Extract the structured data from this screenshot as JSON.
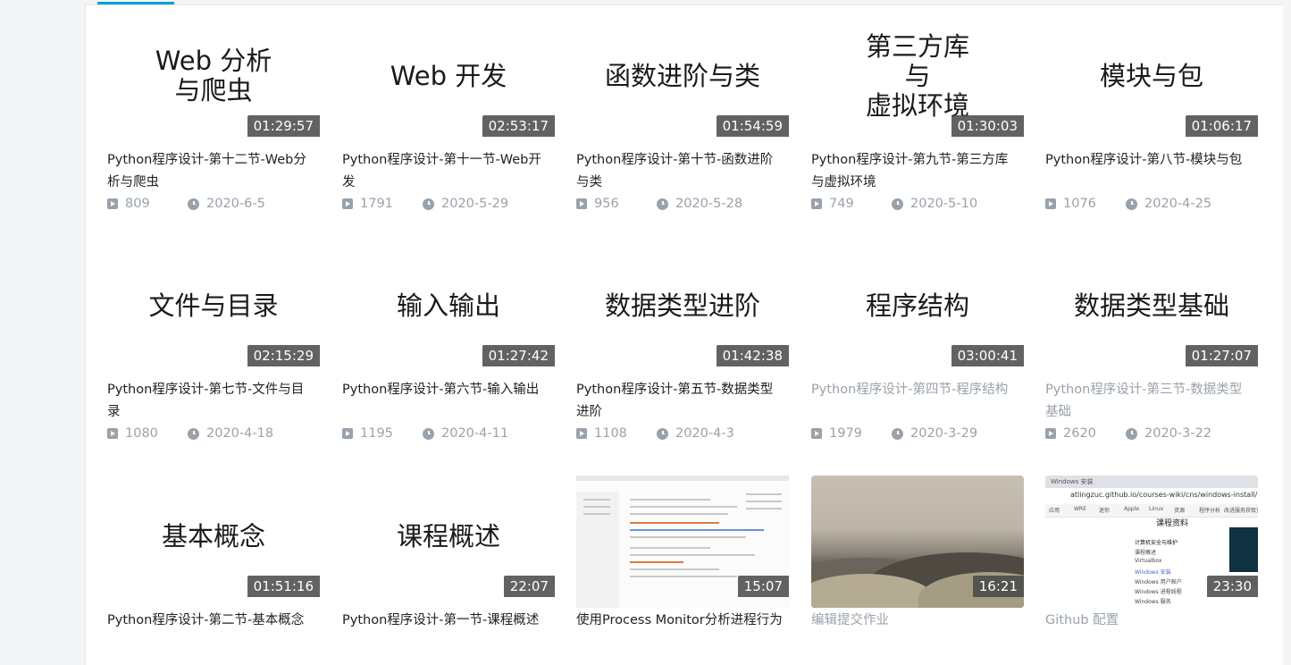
{
  "videos": [
    {
      "thumb_text": "Web 分析\n与爬虫",
      "duration": "01:29:57",
      "title": "Python程序设计-第十二节-Web分析与爬虫",
      "plays": "809",
      "date": "2020-6-5",
      "visited": false
    },
    {
      "thumb_text": "Web 开发",
      "duration": "02:53:17",
      "title": "Python程序设计-第十一节-Web开发",
      "plays": "1791",
      "date": "2020-5-29",
      "visited": false
    },
    {
      "thumb_text": "函数进阶与类",
      "duration": "01:54:59",
      "title": "Python程序设计-第十节-函数进阶与类",
      "plays": "956",
      "date": "2020-5-28",
      "visited": false
    },
    {
      "thumb_text": "第三方库\n与\n虚拟环境",
      "duration": "01:30:03",
      "title": "Python程序设计-第九节-第三方库与虚拟环境",
      "plays": "749",
      "date": "2020-5-10",
      "visited": false
    },
    {
      "thumb_text": "模块与包",
      "duration": "01:06:17",
      "title": "Python程序设计-第八节-模块与包",
      "plays": "1076",
      "date": "2020-4-25",
      "visited": false
    },
    {
      "thumb_text": "文件与目录",
      "duration": "02:15:29",
      "title": "Python程序设计-第七节-文件与目录",
      "plays": "1080",
      "date": "2020-4-18",
      "visited": false
    },
    {
      "thumb_text": "输入输出",
      "duration": "01:27:42",
      "title": "Python程序设计-第六节-输入输出",
      "plays": "1195",
      "date": "2020-4-11",
      "visited": false
    },
    {
      "thumb_text": "数据类型进阶",
      "duration": "01:42:38",
      "title": "Python程序设计-第五节-数据类型进阶",
      "plays": "1108",
      "date": "2020-4-3",
      "visited": false
    },
    {
      "thumb_text": "程序结构",
      "duration": "03:00:41",
      "title": "Python程序设计-第四节-程序结构",
      "plays": "1979",
      "date": "2020-3-29",
      "visited": true
    },
    {
      "thumb_text": "数据类型基础",
      "duration": "01:27:07",
      "title": "Python程序设计-第三节-数据类型基础",
      "plays": "2620",
      "date": "2020-3-22",
      "visited": true
    },
    {
      "thumb_text": "基本概念",
      "duration": "01:51:16",
      "title": "Python程序设计-第二节-基本概念",
      "plays": null,
      "date": null,
      "visited": false
    },
    {
      "thumb_text": "课程概述",
      "duration": "22:07",
      "title": "Python程序设计-第一节-课程概述",
      "plays": null,
      "date": null,
      "visited": false
    },
    {
      "thumb_text": "",
      "duration": "15:07",
      "title": "使用Process Monitor分析进程行为",
      "plays": null,
      "date": null,
      "visited": false
    },
    {
      "thumb_text": "",
      "duration": "16:21",
      "title": "编辑提交作业",
      "plays": null,
      "date": null,
      "visited": true
    },
    {
      "thumb_text": "",
      "duration": "23:30",
      "title": "Github 配置",
      "plays": null,
      "date": null,
      "visited": true
    }
  ],
  "shot_c_text": {
    "tab": "Windows 安装",
    "url": "atlingzuc.github.io/courses-wiki/cns/windows-install/",
    "bookmarks": [
      "应用",
      "WRE",
      "迷你",
      "Apple",
      "Linux",
      "资源",
      "程序分析",
      "改进服务获取资源"
    ],
    "header": "课程资料",
    "items": [
      "计算机安全与维护",
      "课程概述",
      "Virtualbox",
      "Windows 安装",
      "Windows 用户账户",
      "Windows 进程线程",
      "Windows 服务"
    ],
    "side": "Githu"
  },
  "colors": {
    "accent": "#00a1d6",
    "meta": "#99a2aa",
    "title": "#212121"
  }
}
